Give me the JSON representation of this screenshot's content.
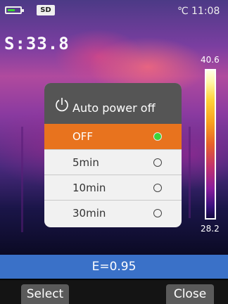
{
  "status": {
    "battery_level": 0.6,
    "sd_label": "SD",
    "temp_unit": "℃",
    "time": "11:08"
  },
  "spot_temp": "S:33.8",
  "scale": {
    "max": "40.6",
    "min": "28.2"
  },
  "dialog": {
    "title": "Auto power off",
    "icon": "power-icon",
    "options": [
      {
        "label": "OFF",
        "selected": true
      },
      {
        "label": "5min",
        "selected": false
      },
      {
        "label": "10min",
        "selected": false
      },
      {
        "label": "30min",
        "selected": false
      }
    ]
  },
  "emissivity": "E=0.95",
  "softkeys": {
    "left": "Select",
    "right": "Close"
  },
  "colors": {
    "accent": "#e8731e",
    "selected_radio": "#3bd53b",
    "info_bar": "#3a71c8"
  }
}
